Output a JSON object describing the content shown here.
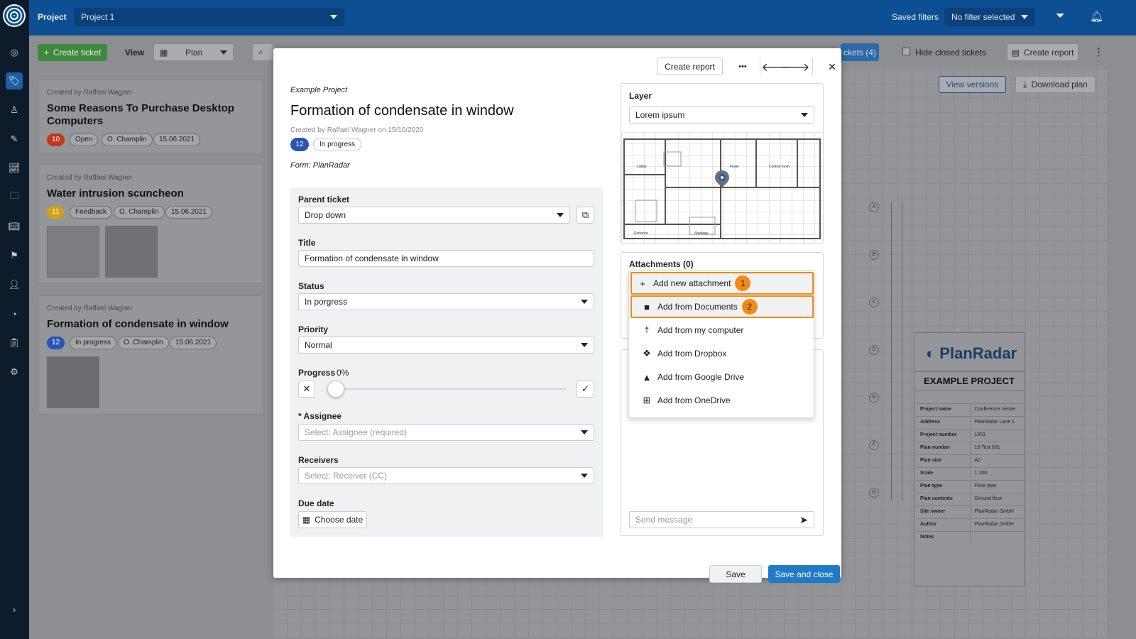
{
  "topbar": {
    "project_label": "Project",
    "project_value": "Project 1",
    "saved_filters_label": "Saved filters",
    "filter_value": "No filter selected"
  },
  "toolbar": {
    "create_ticket": "Create ticket",
    "view_label": "View",
    "view_value": "Plan",
    "tickets_count": "ckets (4)",
    "hide_closed": "Hide closed tickets",
    "create_report": "Create report",
    "view_versions": "View versions",
    "download_plan": "Download plan"
  },
  "tickets": [
    {
      "created_by": "Created by Raffael Wagner",
      "title": "Some Reasons To Purchase Desktop Computers",
      "number": "10",
      "number_color": "#c0391c",
      "status": "Open",
      "assignee": "O. Champlin",
      "date": "15.06.2021"
    },
    {
      "created_by": "Created by Raffael Wagner",
      "title": "Water intrusion scuncheon",
      "number": "11",
      "number_color": "#d4a017",
      "status": "Feedback",
      "assignee": "O. Champlin",
      "date": "15.06.2021"
    },
    {
      "created_by": "Created by Raffael Wagner",
      "title": "Formation of condensate in window",
      "number": "12",
      "number_color": "#2a55b8",
      "status": "In progress",
      "assignee": "O. Champlin",
      "date": "15.06.2021"
    }
  ],
  "modal": {
    "header": {
      "create_report": "Create report",
      "more": "•••",
      "prev": "🡐",
      "next": "🡒",
      "close": "✕"
    },
    "project": "Example Project",
    "title": "Formation of condensate in window",
    "created": "Created by Raffael Wagner on 15/10/2020",
    "number": "12",
    "status_chip": "In progress",
    "form": "Form: PlanRadar",
    "fields": {
      "parent_label": "Parent ticket",
      "parent_value": "Drop down",
      "title_label": "Title",
      "title_value": "Formation of condensate in window",
      "status_label": "Status",
      "status_value": "In porgress",
      "priority_label": "Priority",
      "priority_value": "Normal",
      "progress_label": "Progress",
      "progress_value": "0%",
      "progress_fraction": 0,
      "assignee_label": "* Assignee",
      "assignee_placeholder": "Select: Assignee (required)",
      "receivers_label": "Receivers",
      "receivers_placeholder": "Select: Receiver (CC)",
      "due_label": "Due date",
      "due_button": "Choose date"
    },
    "layer": {
      "label": "Layer",
      "value": "Lorem ipsum"
    },
    "attachments": {
      "label": "Attachments (0)",
      "items": [
        {
          "label": "Add new attachment",
          "icon": "plus-icon",
          "badge": "1"
        },
        {
          "label": "Add from Documents",
          "icon": "folder-icon",
          "badge": "2"
        },
        {
          "label": "Add from my computer",
          "icon": "upload-icon"
        },
        {
          "label": "Add from Dropbox",
          "icon": "dropbox-icon"
        },
        {
          "label": "Add from Google Drive",
          "icon": "google-drive-icon"
        },
        {
          "label": "Add from OneDrive",
          "icon": "windows-icon"
        }
      ]
    },
    "message_placeholder": "Send message",
    "save": "Save",
    "save_close": "Save and close"
  },
  "plan_labels": {
    "lobby": "Lobby",
    "foyer": "Foyer",
    "control": "Control room",
    "entrance": "Entrance",
    "stairway": "Stairway"
  },
  "titleblock": {
    "brand": "PlanRadar",
    "heading": "EXAMPLE PROJECT",
    "rows": [
      [
        "Project name",
        "Conference centre"
      ],
      [
        "Address",
        "PlanRadar Lane 1"
      ],
      [
        "Project number",
        "1001"
      ],
      [
        "Plan number",
        "19 Test 001"
      ],
      [
        "Plan size",
        "A2"
      ],
      [
        "Scale",
        "1:100"
      ],
      [
        "Plan type",
        "Floor plan"
      ],
      [
        "Plan contents",
        "Ground floor"
      ],
      [
        "Site owner",
        "PlanRadar GmbH"
      ],
      [
        "Author",
        "PlanRadar GmbH"
      ],
      [
        "Notes",
        ""
      ]
    ]
  },
  "colors": {
    "brand": "#0c4f93",
    "primary": "#1f7ac7",
    "highlight": "#f18a16"
  }
}
